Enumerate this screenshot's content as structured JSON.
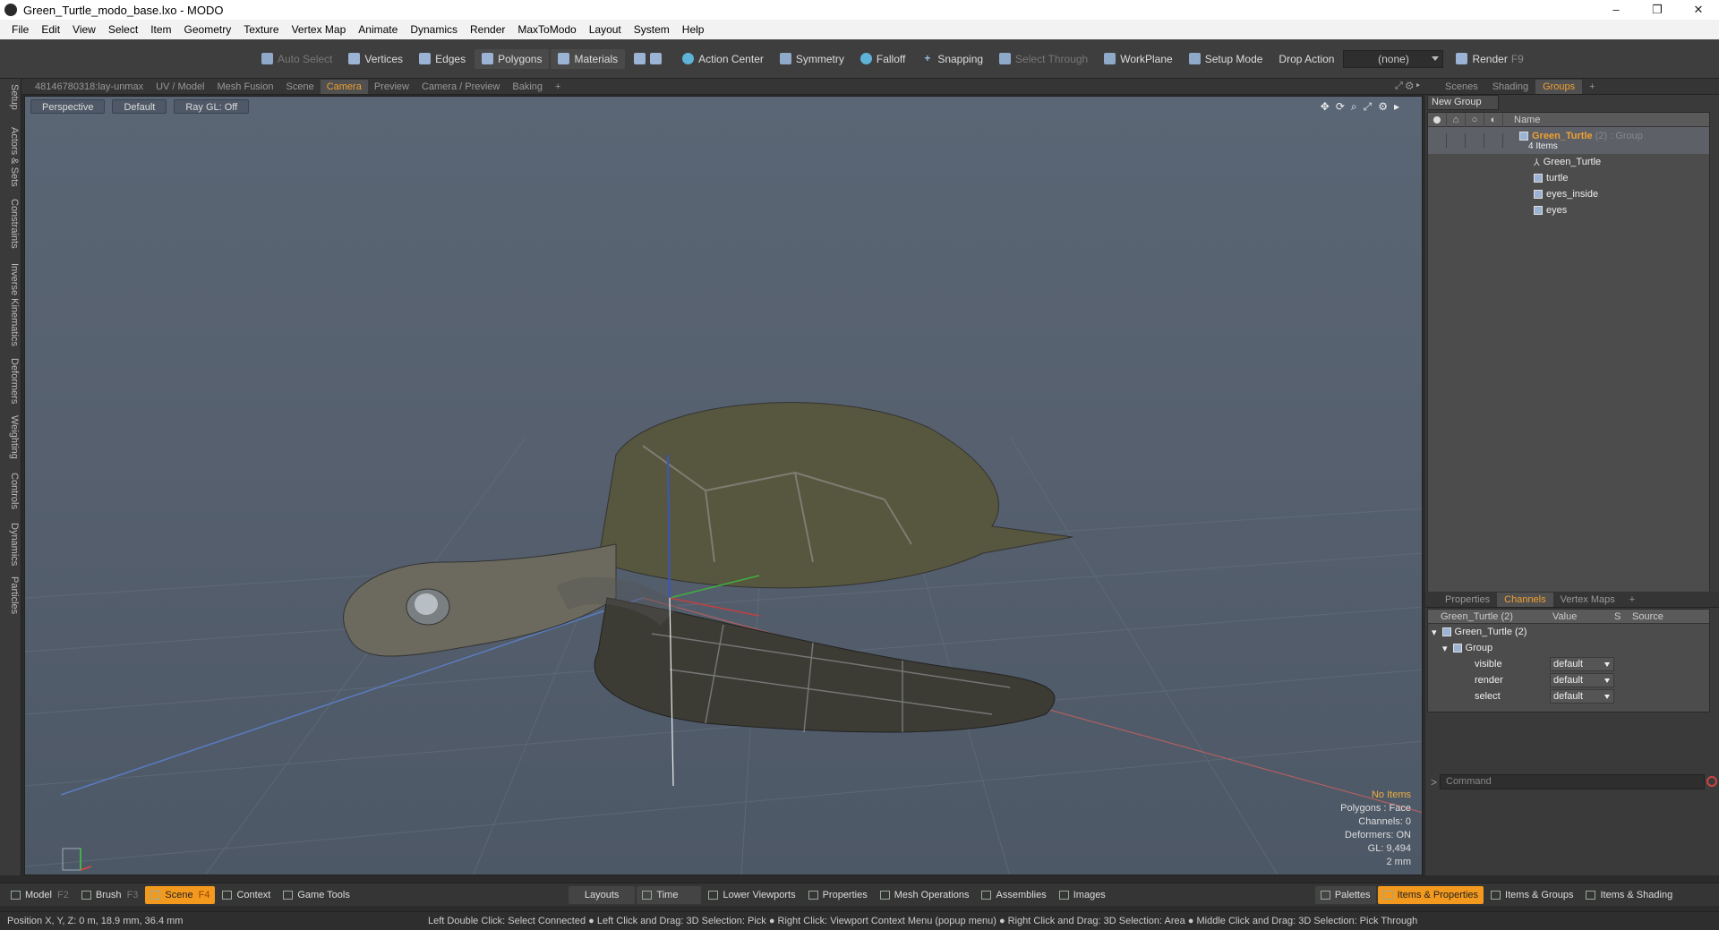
{
  "window": {
    "title": "Green_Turtle_modo_base.lxo - MODO",
    "min": "–",
    "max": "❐",
    "close": "✕"
  },
  "menu": [
    "File",
    "Edit",
    "View",
    "Select",
    "Item",
    "Geometry",
    "Texture",
    "Vertex Map",
    "Animate",
    "Dynamics",
    "Render",
    "MaxToModo",
    "Layout",
    "System",
    "Help"
  ],
  "toolbar": {
    "auto_select": "Auto Select",
    "vertices": "Vertices",
    "edges": "Edges",
    "polygons": "Polygons",
    "materials": "Materials",
    "action_center": "Action Center",
    "symmetry": "Symmetry",
    "falloff": "Falloff",
    "snapping": "Snapping",
    "select_through": "Select Through",
    "workplane": "WorkPlane",
    "setup_mode": "Setup Mode",
    "drop_action": "Drop Action",
    "drop_value": "(none)",
    "render": "Render",
    "render_key": "F9"
  },
  "left_tabs": [
    "Setup",
    "Actors & Sets",
    "Constraints",
    "Inverse Kinematics",
    "Deformers",
    "Weighting",
    "Controls",
    "Dynamics",
    "Particles"
  ],
  "viewport_tabs": [
    "48146780318:lay-unmax",
    "UV / Model",
    "Mesh Fusion",
    "Scene",
    "Camera",
    "Preview",
    "Camera / Preview",
    "Baking",
    "+"
  ],
  "viewport_active_tab": "Camera",
  "viewport": {
    "perspective": "Perspective",
    "default": "Default",
    "raygl": "Ray GL: Off",
    "hud": {
      "no_items": "No Items",
      "polygons": "Polygons : Face",
      "channels": "Channels: 0",
      "deformers": "Deformers: ON",
      "gl": "GL: 9,494",
      "scale": "2 mm"
    }
  },
  "right_tabs": [
    "Scenes",
    "Shading",
    "Groups",
    "+"
  ],
  "right_active": "Groups",
  "groups": {
    "new_group": "New Group",
    "name_header": "Name",
    "root": {
      "name": "Green_Turtle",
      "suffix": "(2)",
      "type": ": Group",
      "count": "4 Items"
    },
    "items": [
      "Green_Turtle",
      "turtle",
      "eyes_inside",
      "eyes"
    ]
  },
  "channels": {
    "tabs": [
      "Properties",
      "Channels",
      "Vertex Maps",
      "+"
    ],
    "active": "Channels",
    "header": {
      "name": "Green_Turtle (2)",
      "value": "Value",
      "s": "S",
      "source": "Source"
    },
    "root": "Green_Turtle (2)",
    "group": "Group",
    "rows": [
      {
        "name": "visible",
        "value": "default"
      },
      {
        "name": "render",
        "value": "default"
      },
      {
        "name": "select",
        "value": "default"
      }
    ],
    "command_placeholder": "Command"
  },
  "bottom": {
    "model": "Model",
    "model_key": "F2",
    "brush": "Brush",
    "brush_key": "F3",
    "scene": "Scene",
    "scene_key": "F4",
    "context": "Context",
    "game_tools": "Game Tools",
    "layouts": "Layouts",
    "time": "Time",
    "lower_viewports": "Lower Viewports",
    "properties": "Properties",
    "mesh_operations": "Mesh Operations",
    "assemblies": "Assemblies",
    "images": "Images",
    "palettes": "Palettes",
    "items_properties": "Items & Properties",
    "items_groups": "Items & Groups",
    "items_shading": "Items & Shading"
  },
  "status": {
    "position": "Position X, Y, Z:   0 m, 18.9 mm, 36.4 mm",
    "hint": "Left Double Click: Select Connected ● Left Click and Drag: 3D Selection: Pick ● Right Click: Viewport Context Menu (popup menu) ● Right Click and Drag: 3D Selection: Area ● Middle Click and Drag: 3D Selection: Pick Through"
  },
  "colors": {
    "accent": "#f0a030",
    "active_layout": "#f39a1e"
  }
}
